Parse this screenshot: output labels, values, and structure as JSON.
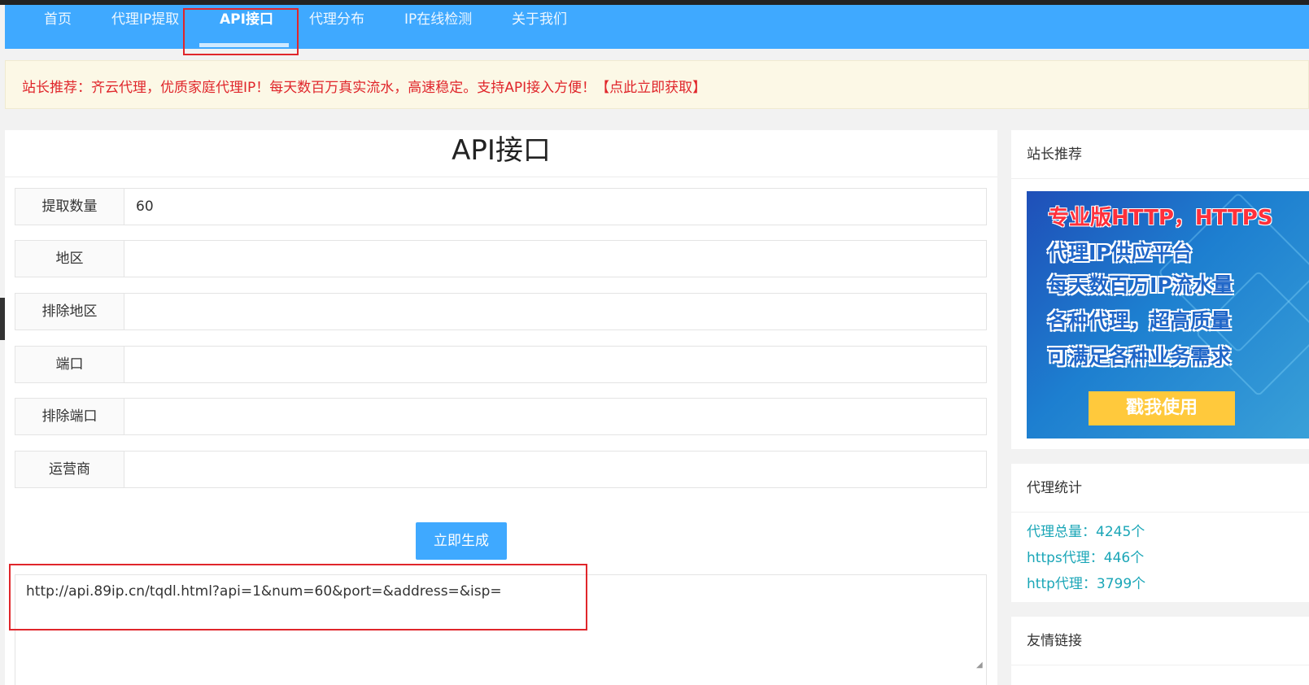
{
  "nav": {
    "items": [
      {
        "label": "首页"
      },
      {
        "label": "代理IP提取"
      },
      {
        "label": "API接口"
      },
      {
        "label": "代理分布"
      },
      {
        "label": "IP在线检测"
      },
      {
        "label": "关于我们"
      }
    ],
    "active_index": 2
  },
  "notice": {
    "text": "站长推荐：齐云代理，优质家庭代理IP！每天数百万真实流水，高速稳定。支持API接入方便！【点此立即获取】"
  },
  "main": {
    "title": "API接口",
    "fields": [
      {
        "label": "提取数量",
        "value": "60"
      },
      {
        "label": "地区",
        "value": ""
      },
      {
        "label": "排除地区",
        "value": ""
      },
      {
        "label": "端口",
        "value": ""
      },
      {
        "label": "排除端口",
        "value": ""
      },
      {
        "label": "运营商",
        "value": ""
      }
    ],
    "generate_label": "立即生成",
    "result_url": "http://api.89ip.cn/tqdl.html?api=1&num=60&port=&address=&isp="
  },
  "sidebar": {
    "recommend": {
      "title": "站长推荐",
      "banner_lines": [
        "专业版HTTP，HTTPS",
        "代理IP供应平台",
        "每天数百万IP流水量",
        "各种代理，超高质量",
        "可满足各种业务需求"
      ],
      "banner_button": "戳我使用"
    },
    "stats": {
      "title": "代理统计",
      "items": [
        "代理总量：4245个",
        "https代理：446个",
        "http代理：3799个"
      ]
    },
    "links": {
      "title": "友情链接"
    }
  },
  "colors": {
    "nav_bg": "#3fa9ff",
    "notice_text": "#e0262b",
    "stat_text": "#1aa6b7",
    "highlight_box": "#e0262b"
  }
}
